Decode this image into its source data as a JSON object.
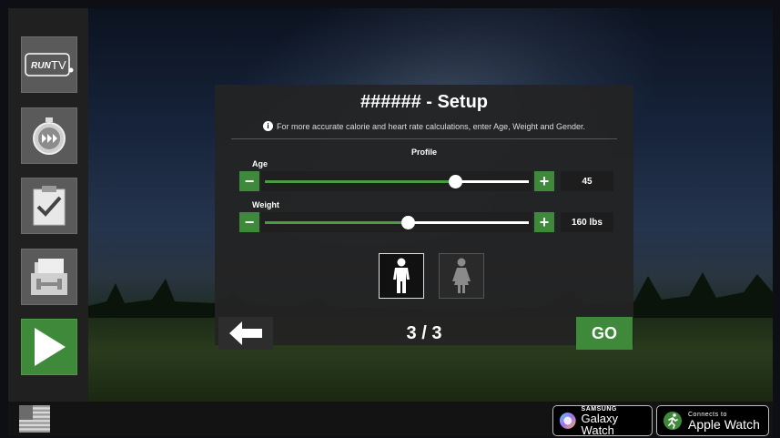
{
  "rail": {
    "items": [
      {
        "name": "runtv-logo",
        "label": "RUNTV"
      },
      {
        "name": "stopwatch"
      },
      {
        "name": "clipboard-check"
      },
      {
        "name": "saved-workouts"
      },
      {
        "name": "play"
      }
    ]
  },
  "dialog": {
    "title": "###### - Setup",
    "info": "For more accurate calorie and heart rate calculations, enter Age, Weight and Gender.",
    "section_label": "Profile",
    "fields": {
      "age": {
        "label": "Age",
        "value": "45",
        "level": 0.72
      },
      "weight": {
        "label": "Weight",
        "value": "160 lbs",
        "level": 0.54
      }
    },
    "gender": {
      "selected": "male"
    },
    "step": "3 / 3",
    "go_label": "GO"
  },
  "bottom": {
    "samsung": {
      "small": "SAMSUNG",
      "big": "Galaxy Watch"
    },
    "apple": {
      "small": "Connects to",
      "big": "Apple Watch"
    }
  },
  "colors": {
    "accent_green": "#3f8a3a",
    "panel": "#242424"
  }
}
